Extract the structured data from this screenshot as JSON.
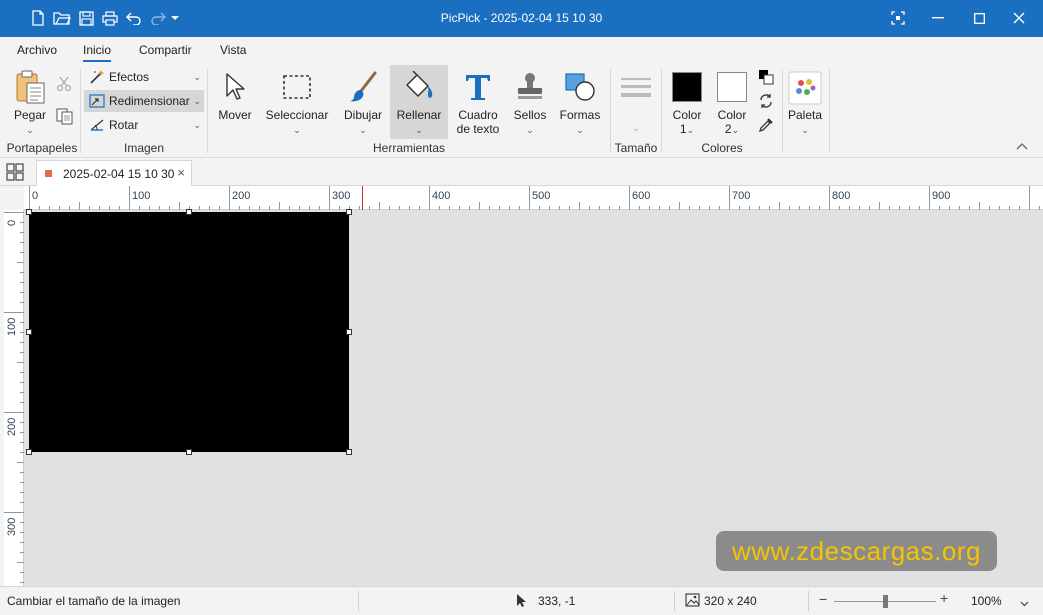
{
  "window": {
    "title": "PicPick - 2025-02-04 15 10 30"
  },
  "menu_tabs": [
    {
      "label": "Archivo"
    },
    {
      "label": "Inicio"
    },
    {
      "label": "Compartir"
    },
    {
      "label": "Vista"
    }
  ],
  "ribbon": {
    "portapapeles": {
      "label": "Portapapeles",
      "paste_label": "Pegar"
    },
    "imagen": {
      "label": "Imagen",
      "items": [
        {
          "label": "Efectos"
        },
        {
          "label": "Redimensionar"
        },
        {
          "label": "Rotar"
        }
      ]
    },
    "herramientas": {
      "label": "Herramientas",
      "tools": [
        {
          "label": "Mover"
        },
        {
          "label": "Seleccionar"
        },
        {
          "label": "Dibujar"
        },
        {
          "label": "Rellenar"
        },
        {
          "label_line1": "Cuadro",
          "label_line2": "de texto"
        },
        {
          "label": "Sellos"
        },
        {
          "label": "Formas"
        }
      ]
    },
    "tamano": {
      "label": "Tamaño"
    },
    "colores": {
      "label": "Colores",
      "color1": {
        "label": "Color",
        "index": "1",
        "swatch": "#000000"
      },
      "color2": {
        "label": "Color",
        "index": "2",
        "swatch": "#ffffff"
      }
    },
    "paleta": {
      "label": "Paleta"
    }
  },
  "document_tab": {
    "label": "2025-02-04 15 10 30"
  },
  "rulers": {
    "horizontal": [
      "0",
      "100",
      "200",
      "300",
      "400",
      "500",
      "600",
      "700",
      "800",
      "900"
    ],
    "vertical": [
      "0",
      "100",
      "200",
      "300"
    ]
  },
  "watermark": {
    "text": "www.zdescargas.org"
  },
  "status": {
    "message": "Cambiar el tamaño de la imagen",
    "cursor_position": "333, -1",
    "image_size": "320 x 240",
    "zoom": "100%",
    "zoom_percent": 100
  },
  "colors": {
    "titlebar": "#1a6fc0",
    "accent": "#1a6fc0",
    "canvas_bg": "#e1e1e1",
    "image": "#000000",
    "watermark_text": "#f5c400"
  }
}
